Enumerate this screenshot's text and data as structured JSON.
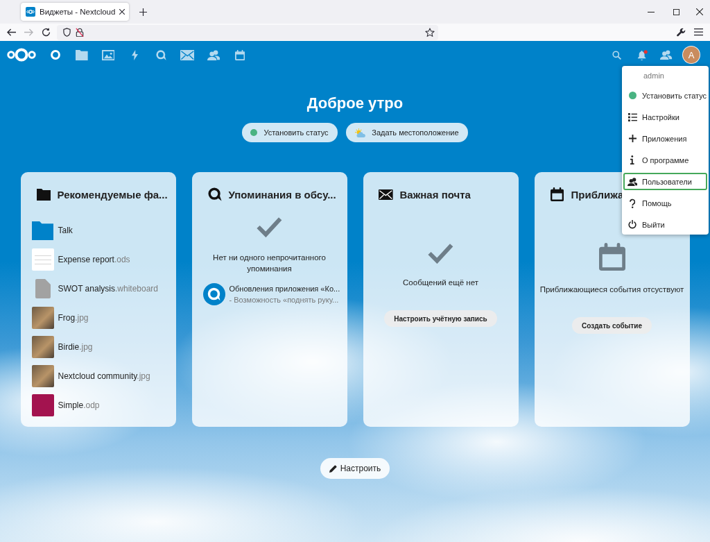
{
  "browser": {
    "tabs": [
      {
        "title": "Виджеты - Nextcloud",
        "selected": true
      }
    ],
    "nav_buttons": [
      {
        "kind": "back",
        "disabled": false
      },
      {
        "kind": "forward",
        "disabled": true
      },
      {
        "kind": "reload",
        "disabled": false
      }
    ]
  },
  "user": {
    "online": true,
    "initial": "A"
  },
  "header": {
    "apps": [
      {
        "kind": "dashboard",
        "selected": true
      },
      {
        "kind": "files",
        "selected": false
      },
      {
        "kind": "photos",
        "selected": false
      },
      {
        "kind": "activity",
        "selected": false
      },
      {
        "kind": "talk",
        "selected": false
      },
      {
        "kind": "mail",
        "selected": false
      },
      {
        "kind": "contacts",
        "selected": false
      },
      {
        "kind": "calendar",
        "selected": false
      }
    ],
    "notifications_unread": true
  },
  "greeting": "Доброе утро",
  "status_actions": [
    {
      "kind": "status",
      "label": "Установить статус"
    },
    {
      "kind": "location",
      "label": "Задать местоположение"
    }
  ],
  "widgets": [
    {
      "kind": "files",
      "title": "Рекомендуемые фа...",
      "files": [
        {
          "kind": "folder",
          "name": "Talk"
        },
        {
          "kind": "spreadsheet",
          "name": "Expense report",
          "extension": ".ods"
        },
        {
          "kind": "file",
          "name": "SWOT analysis",
          "extension": ".whiteboard"
        },
        {
          "kind": "photo",
          "name": "Frog",
          "extension": ".jpg"
        },
        {
          "kind": "photo",
          "name": "Birdie",
          "extension": ".jpg"
        },
        {
          "kind": "photo",
          "name": "Nextcloud community",
          "extension": ".jpg"
        },
        {
          "kind": "presentation",
          "name": "Simple",
          "extension": ".odp"
        }
      ]
    },
    {
      "kind": "talk",
      "title": "Упоминания в обсу...",
      "empty_text": "Нет ни одного непрочитанного упоминания",
      "mentions": [
        {
          "title": "Обновления приложения «Ко...",
          "subtitle": "- Возможность «поднять руку..."
        }
      ]
    },
    {
      "kind": "mail",
      "title": "Важная почта",
      "empty_text": "Сообщений ещё нет",
      "action": "Настроить учётную запись"
    },
    {
      "kind": "calendar",
      "title": "Приближа",
      "empty_text": "Приближающиеся события отсуствуют",
      "action": "Создать событие"
    }
  ],
  "customize_button": "Настроить",
  "user_menu": {
    "username": "admin",
    "items": [
      {
        "kind": "status",
        "label": "Установить статус",
        "selected": false
      },
      {
        "kind": "settings",
        "label": "Настройки",
        "selected": false
      },
      {
        "kind": "apps",
        "label": "Приложения",
        "selected": false
      },
      {
        "kind": "about",
        "label": "О программе",
        "selected": false
      },
      {
        "kind": "users",
        "label": "Пользователи",
        "selected": true
      },
      {
        "kind": "help",
        "label": "Помощь",
        "selected": false
      },
      {
        "kind": "logout",
        "label": "Выйти",
        "selected": false
      }
    ]
  }
}
